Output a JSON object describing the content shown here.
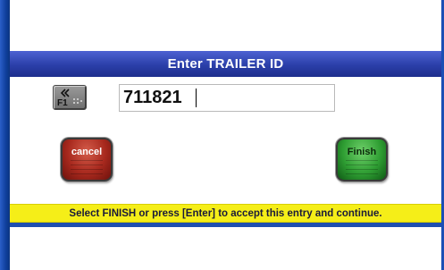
{
  "dialog": {
    "title": "Enter TRAILER ID",
    "input_value": "711821",
    "f1_key_label": "F1",
    "cancel_label": "cancel",
    "finish_label": "Finish",
    "status_message": "Select FINISH or press [Enter] to accept this entry and continue."
  },
  "icons": {
    "f1_key": "double-chevron-left-icon"
  },
  "colors": {
    "frame": "#0d3f9a",
    "title_bar": "#2b3fa9",
    "status_bar": "#f5ee18",
    "cancel_button": "#a8291e",
    "finish_button": "#2f9e33"
  }
}
